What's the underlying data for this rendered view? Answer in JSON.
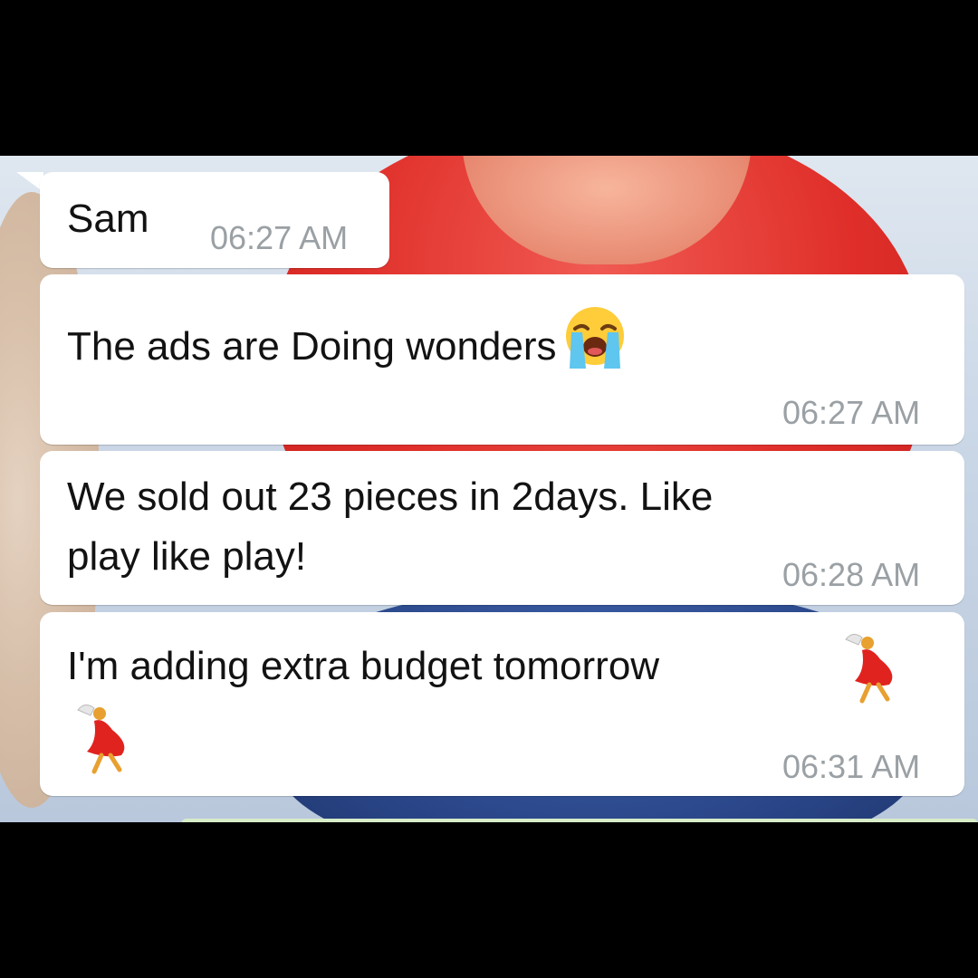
{
  "messages": [
    {
      "text": "Sam",
      "time": "06:27 AM"
    },
    {
      "text": "The ads are Doing wonders",
      "emoji": "loudly-crying-face-icon",
      "time": "06:27 AM"
    },
    {
      "text_line1": "We sold out 23 pieces in 2days. Like",
      "text_line2": "play like play!",
      "time": "06:28 AM"
    },
    {
      "text": "I'm adding extra budget tomorrow",
      "emoji": "woman-dancing-icon",
      "time": "06:31 AM"
    }
  ],
  "colors": {
    "bubble": "#ffffff",
    "timestamp": "#9aa0a4",
    "text": "#121212",
    "letterbox": "#000000"
  }
}
